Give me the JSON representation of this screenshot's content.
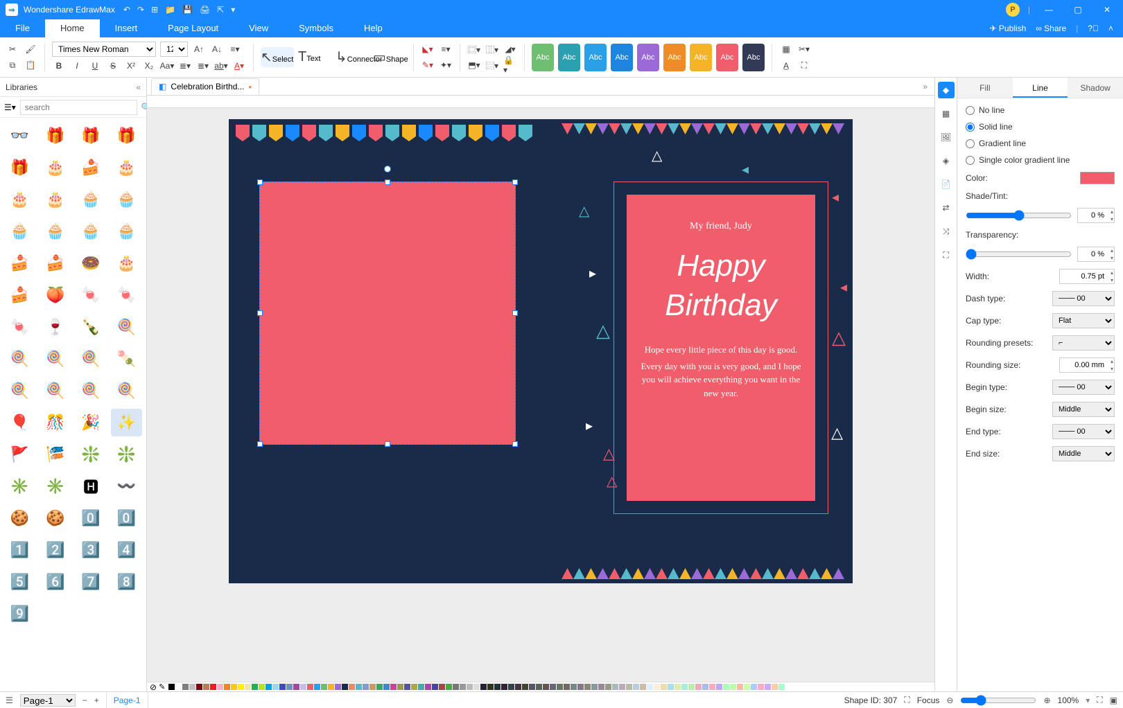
{
  "app": {
    "title": "Wondershare EdrawMax"
  },
  "menubar": {
    "tabs": [
      "File",
      "Home",
      "Insert",
      "Page Layout",
      "View",
      "Symbols",
      "Help"
    ],
    "active": 1,
    "publish": "Publish",
    "share": "Share"
  },
  "ribbon": {
    "font_name": "Times New Roman",
    "font_size": "12",
    "tools": {
      "select": "Select",
      "text": "Text",
      "connector": "Connector",
      "shape": "Shape"
    },
    "styles_label": "Abc",
    "style_colors": [
      "#6fbf73",
      "#2aa0b0",
      "#2aa0e8",
      "#1f86e0",
      "#9c6ad6",
      "#f08c27",
      "#f5b327",
      "#ef5e6a",
      "#323a56"
    ]
  },
  "libraries": {
    "title": "Libraries",
    "search_placeholder": "search",
    "items": [
      "👓",
      "🎁",
      "🎁",
      "🎁",
      "🎁",
      "🎂",
      "🍰",
      "🎂",
      "🎂",
      "🎂",
      "🧁",
      "🧁",
      "🧁",
      "🧁",
      "🧁",
      "🧁",
      "🍰",
      "🍰",
      "🍩",
      "🎂",
      "🍰",
      "🍑",
      "🍬",
      "🍬",
      "🍬",
      "🍷",
      "🍾",
      "🍭",
      "🍭",
      "🍭",
      "🍭",
      "🍡",
      "🍭",
      "🍭",
      "🍭",
      "🍭",
      "🎈",
      "🎊",
      "🎉",
      "✨",
      "🚩",
      "🎏",
      "❇️",
      "❇️",
      "✳️",
      "✳️",
      "🅷",
      "〰️",
      "🍪",
      "🍪",
      "0️⃣",
      "0️⃣",
      "1️⃣",
      "2️⃣",
      "3️⃣",
      "4️⃣",
      "5️⃣",
      "6️⃣",
      "7️⃣",
      "8️⃣",
      "9️⃣"
    ],
    "selected_index": 39
  },
  "document": {
    "tab_title": "Celebration Birthd...",
    "modified": "•",
    "card": {
      "line1": "My friend, Judy",
      "hb1": "Happy",
      "hb2": "Birthday",
      "body1": "Hope every little piece of this day is good.",
      "body2": "Every day with you is very good, and I hope you will achieve everything you want in the new year."
    }
  },
  "right_panel": {
    "tabs": [
      "Fill",
      "Line",
      "Shadow"
    ],
    "active": 1,
    "line_type": {
      "no_line": "No line",
      "solid": "Solid line",
      "gradient": "Gradient line",
      "single_gradient": "Single color gradient line",
      "selected": "solid"
    },
    "color_label": "Color:",
    "color_value": "#ef5e6a",
    "shade_label": "Shade/Tint:",
    "shade_value": "0 %",
    "transparency_label": "Transparency:",
    "transparency_value": "0 %",
    "width_label": "Width:",
    "width_value": "0.75 pt",
    "dash_label": "Dash type:",
    "dash_value": "─── 00",
    "cap_label": "Cap type:",
    "cap_value": "Flat",
    "round_preset_label": "Rounding presets:",
    "round_size_label": "Rounding size:",
    "round_size_value": "0.00 mm",
    "begin_type_label": "Begin type:",
    "begin_type_value": "─── 00",
    "begin_size_label": "Begin size:",
    "begin_size_value": "Middle",
    "end_type_label": "End type:",
    "end_type_value": "─── 00",
    "end_size_label": "End size:",
    "end_size_value": "Middle"
  },
  "status": {
    "page_label": "Page-1",
    "page_name": "Page-1",
    "shape_id_label": "Shape ID: 307",
    "focus": "Focus",
    "zoom": "100%"
  },
  "palette": [
    "#000000",
    "#ffffff",
    "#7f7f7f",
    "#c0c0c0",
    "#880015",
    "#b97a57",
    "#ed1c24",
    "#ffaec9",
    "#ff7f27",
    "#ffc90e",
    "#fff200",
    "#efe4b0",
    "#22b14c",
    "#b5e61d",
    "#00a2e8",
    "#99d9ea",
    "#3f48cc",
    "#7092be",
    "#a349a4",
    "#c8bfe7",
    "#ef5e6a",
    "#2aa0e8",
    "#6fbf73",
    "#f5b327",
    "#9c6ad6",
    "#1a2b4a",
    "#e86",
    "#5bc",
    "#89c",
    "#c96",
    "#3a6",
    "#48c",
    "#c49",
    "#995",
    "#559",
    "#aa4",
    "#4aa",
    "#a4a",
    "#44a",
    "#a44",
    "#4a4",
    "#777",
    "#999",
    "#bbb",
    "#ddd",
    "#223",
    "#332",
    "#233",
    "#323",
    "#344",
    "#434",
    "#443",
    "#556",
    "#565",
    "#655",
    "#667",
    "#676",
    "#766",
    "#788",
    "#878",
    "#887",
    "#899",
    "#989",
    "#998",
    "#abb",
    "#bab",
    "#bba",
    "#bcd",
    "#cba",
    "#def",
    "#fed",
    "#eda",
    "#ade",
    "#dea",
    "#aed",
    "#bea",
    "#eab",
    "#abe",
    "#fab",
    "#baf",
    "#afb",
    "#bfa",
    "#fba",
    "#cfa",
    "#acf",
    "#fac",
    "#caf",
    "#fca",
    "#afc"
  ]
}
